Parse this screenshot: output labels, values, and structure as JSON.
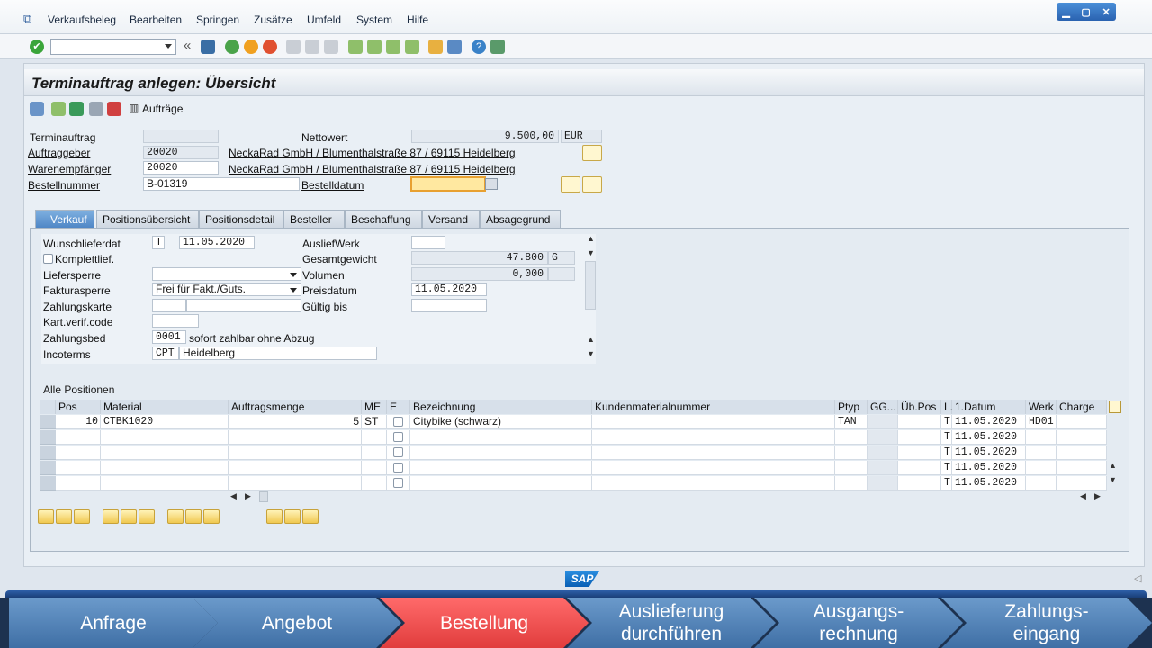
{
  "menu": [
    "Verkaufsbeleg",
    "Bearbeiten",
    "Springen",
    "Zusätze",
    "Umfeld",
    "System",
    "Hilfe"
  ],
  "window_buttons": [
    "▁",
    "▢",
    "✕"
  ],
  "page_title": "Terminauftrag anlegen: Übersicht",
  "app_toolbar": {
    "auftraege_label": "Aufträge"
  },
  "header": {
    "terminauftrag_label": "Terminauftrag",
    "terminauftrag_value": "",
    "nettowert_label": "Nettowert",
    "nettowert_value": "9.500,00",
    "currency": "EUR",
    "auftraggeber_label": "Auftraggeber",
    "auftraggeber_value": "20020",
    "auftraggeber_text": "NeckaRad GmbH / Blumenthalstraße 87 / 69115 Heidelberg",
    "warenempfaenger_label": "Warenempfänger",
    "warenempfaenger_value": "20020",
    "warenempfaenger_text": "NeckaRad GmbH / Blumenthalstraße 87 / 69115 Heidelberg",
    "bestellnummer_label": "Bestellnummer",
    "bestellnummer_value": "B-01319",
    "bestelldatum_label": "Bestelldatum",
    "bestelldatum_value": ""
  },
  "tabs": [
    "Verkauf",
    "Positionsübersicht",
    "Positionsdetail",
    "Besteller",
    "Beschaffung",
    "Versand",
    "Absagegrund"
  ],
  "verkauf": {
    "wunschlieferdat_label": "Wunschlieferdat",
    "wunschlieferdat_type": "T",
    "wunschlieferdat_value": "11.05.2020",
    "auslief_werk_label": "AusliefWerk",
    "komplettlief_label": "Komplettlief.",
    "gesamtgewicht_label": "Gesamtgewicht",
    "gesamtgewicht_value": "47.800",
    "gewicht_unit": "G",
    "liefersperre_label": "Liefersperre",
    "volumen_label": "Volumen",
    "volumen_value": "0,000",
    "fakturasperre_label": "Fakturasperre",
    "fakturasperre_value": "Frei für Fakt./Guts.",
    "preisdatum_label": "Preisdatum",
    "preisdatum_value": "11.05.2020",
    "zahlungskarte_label": "Zahlungskarte",
    "gueltig_bis_label": "Gültig bis",
    "kart_verif_label": "Kart.verif.code",
    "zahlungsbed_label": "Zahlungsbed",
    "zahlungsbed_value": "0001",
    "zahlungsbed_text": "sofort zahlbar ohne Abzug",
    "incoterms_label": "Incoterms",
    "incoterms_value": "CPT",
    "incoterms_text": "Heidelberg"
  },
  "positions": {
    "title": "Alle Positionen",
    "columns": [
      "Pos",
      "Material",
      "Auftragsmenge",
      "ME",
      "E",
      "Bezeichnung",
      "Kundenmaterialnummer",
      "Ptyp",
      "GG...",
      "Üb.Pos",
      "L.",
      "1.Datum",
      "Werk",
      "Charge"
    ],
    "rows": [
      {
        "pos": "10",
        "material": "CTBK1020",
        "menge": "5",
        "me": "ST",
        "bezeichnung": "Citybike (schwarz)",
        "ptyp": "TAN",
        "l": "T",
        "datum": "11.05.2020",
        "werk": "HD01"
      },
      {
        "pos": "",
        "material": "",
        "menge": "",
        "me": "",
        "bezeichnung": "",
        "ptyp": "",
        "l": "T",
        "datum": "11.05.2020",
        "werk": ""
      },
      {
        "pos": "",
        "material": "",
        "menge": "",
        "me": "",
        "bezeichnung": "",
        "ptyp": "",
        "l": "T",
        "datum": "11.05.2020",
        "werk": ""
      },
      {
        "pos": "",
        "material": "",
        "menge": "",
        "me": "",
        "bezeichnung": "",
        "ptyp": "",
        "l": "T",
        "datum": "11.05.2020",
        "werk": ""
      },
      {
        "pos": "",
        "material": "",
        "menge": "",
        "me": "",
        "bezeichnung": "",
        "ptyp": "",
        "l": "T",
        "datum": "11.05.2020",
        "werk": ""
      }
    ]
  },
  "sap_logo": "SAP",
  "process_steps": [
    {
      "label": "Anfrage",
      "active": false
    },
    {
      "label": "Angebot",
      "active": false
    },
    {
      "label": "Bestellung",
      "active": true
    },
    {
      "label": "Auslieferung durchführen",
      "active": false
    },
    {
      "label": "Ausgangs-rechnung",
      "active": false
    },
    {
      "label": "Zahlungs-eingang",
      "active": false
    }
  ]
}
